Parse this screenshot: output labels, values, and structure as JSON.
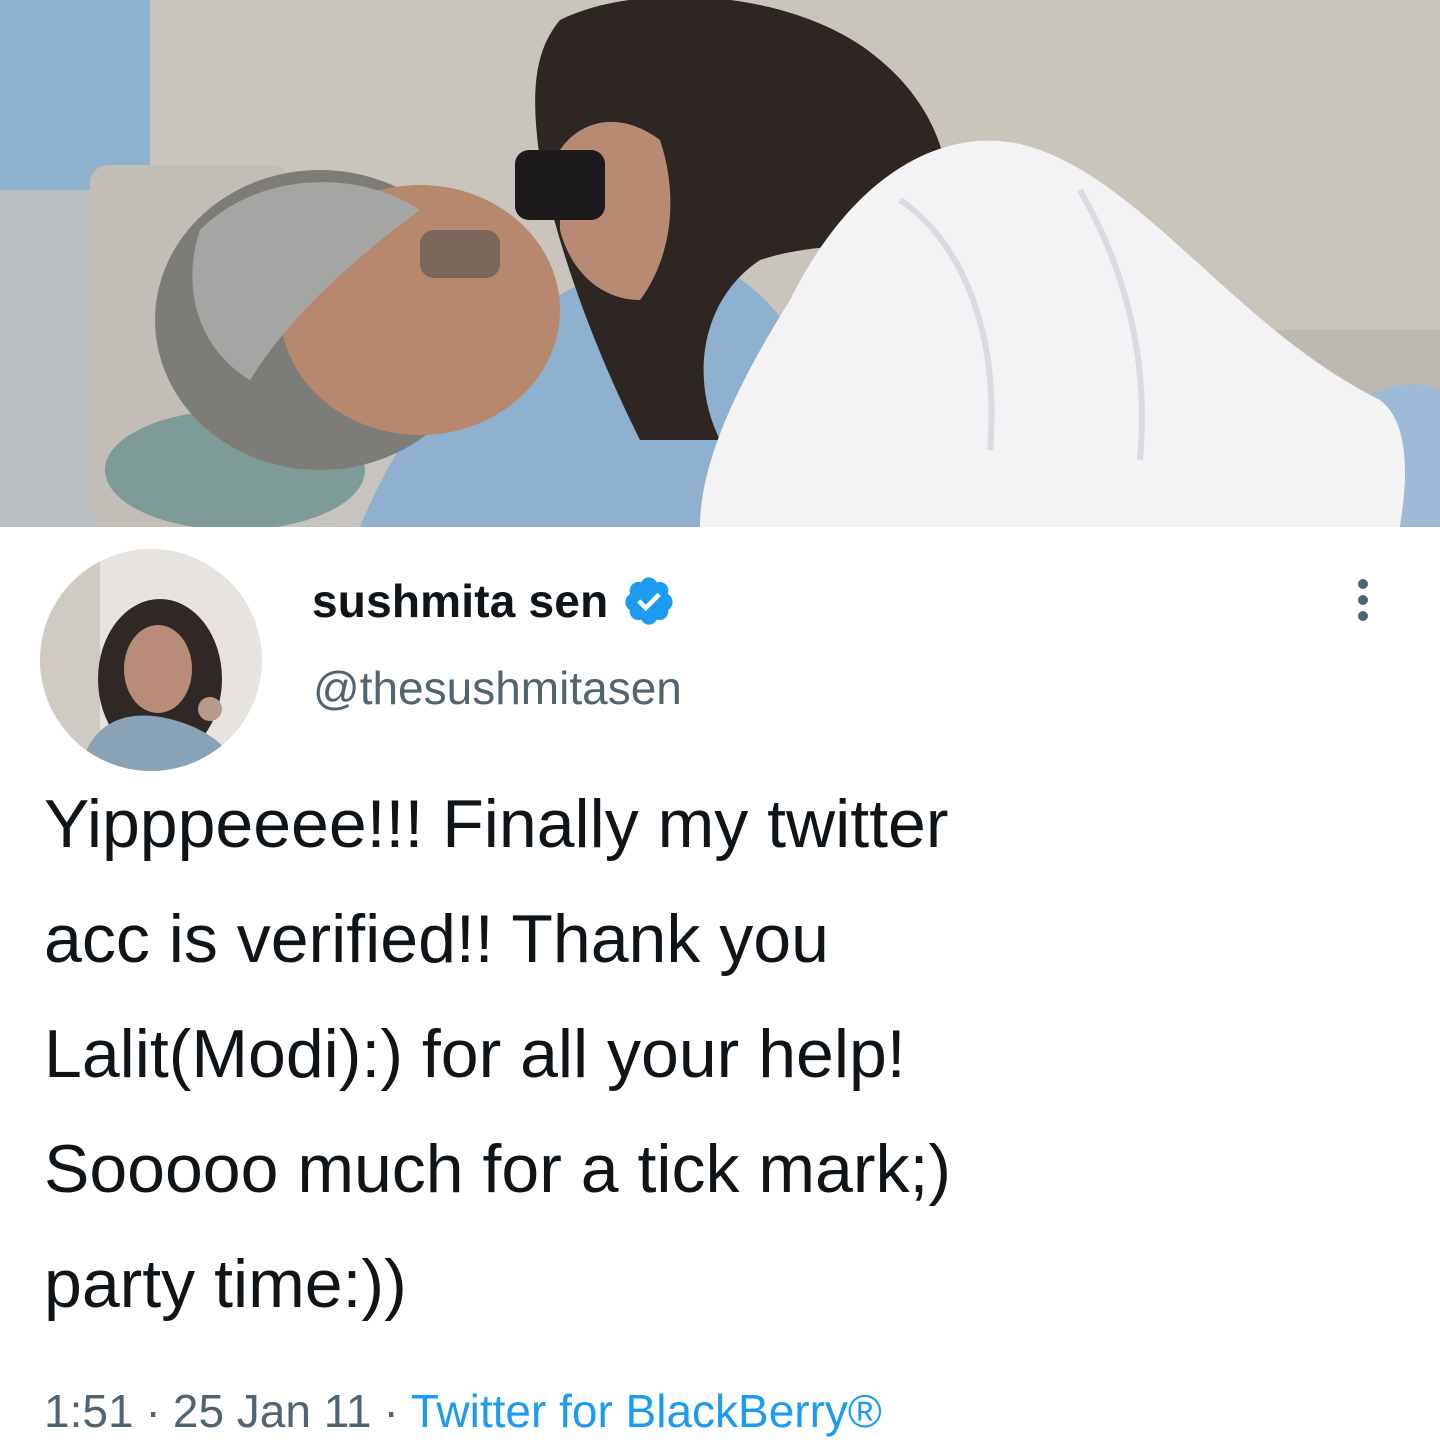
{
  "photo": {
    "description_icon": "photo-image"
  },
  "tweet": {
    "author": {
      "display_name": "sushmita sen",
      "handle": "@thesushmitasen",
      "verified": true,
      "avatar_icon": "profile-photo"
    },
    "text": "Yipppeeee!!! Finally my twitter\nacc is verified!! Thank you\nLalit(Modi):) for all your help!\nSooooo much for a tick mark;)\nparty time:))",
    "meta": {
      "time": "1:51",
      "separator": "·",
      "date": "25 Jan 11",
      "source": "Twitter for BlackBerry®"
    },
    "more_icon": "more-options-icon"
  },
  "colors": {
    "text_primary": "#0f1419",
    "text_secondary": "#536471",
    "accent_blue": "#1d9bf0",
    "verified_blue": "#1d9bf0"
  }
}
